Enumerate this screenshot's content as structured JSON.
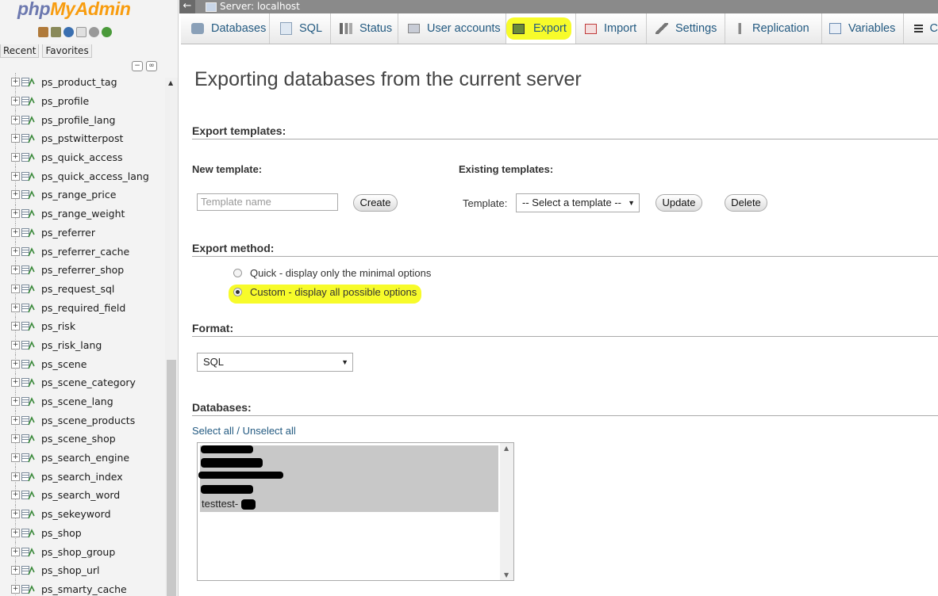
{
  "sidebar": {
    "logo": {
      "php": "php",
      "my": "My",
      "admin": "Admin"
    },
    "nav_icons": [
      "home-icon",
      "logout-icon",
      "help-icon",
      "docs-icon",
      "settings-icon",
      "reload-icon"
    ],
    "tabs": {
      "recent": "Recent",
      "favorites": "Favorites"
    },
    "collapse_all": "−",
    "link_with_main": "∞",
    "expand_glyph": "+",
    "scroll_up": "▲",
    "tables": [
      "ps_product_tag",
      "ps_profile",
      "ps_profile_lang",
      "ps_pstwitterpost",
      "ps_quick_access",
      "ps_quick_access_lang",
      "ps_range_price",
      "ps_range_weight",
      "ps_referrer",
      "ps_referrer_cache",
      "ps_referrer_shop",
      "ps_request_sql",
      "ps_required_field",
      "ps_risk",
      "ps_risk_lang",
      "ps_scene",
      "ps_scene_category",
      "ps_scene_lang",
      "ps_scene_products",
      "ps_scene_shop",
      "ps_search_engine",
      "ps_search_index",
      "ps_search_word",
      "ps_sekeyword",
      "ps_shop",
      "ps_shop_group",
      "ps_shop_url",
      "ps_smarty_cache"
    ]
  },
  "topbar": {
    "back": "←",
    "server": "Server: localhost"
  },
  "tabs": [
    {
      "label": "Databases",
      "icon": "database-icon"
    },
    {
      "label": "SQL",
      "icon": "sql-icon"
    },
    {
      "label": "Status",
      "icon": "status-icon"
    },
    {
      "label": "User accounts",
      "icon": "users-icon"
    },
    {
      "label": "Export",
      "icon": "export-icon",
      "active": true
    },
    {
      "label": "Import",
      "icon": "import-icon"
    },
    {
      "label": "Settings",
      "icon": "wrench-icon"
    },
    {
      "label": "Replication",
      "icon": "replication-icon"
    },
    {
      "label": "Variables",
      "icon": "variables-icon"
    },
    {
      "label": "C",
      "icon": "charset-icon"
    }
  ],
  "main": {
    "title": "Exporting databases from the current server",
    "export_templates": {
      "heading": "Export templates:",
      "new_template_label": "New template:",
      "template_name_placeholder": "Template name",
      "create_button": "Create",
      "existing_templates_label": "Existing templates:",
      "template_label": "Template:",
      "template_select": "-- Select a template --",
      "update_button": "Update",
      "delete_button": "Delete"
    },
    "export_method": {
      "heading": "Export method:",
      "quick": "Quick - display only the minimal options",
      "custom": "Custom - display all possible options",
      "selected": "custom"
    },
    "format": {
      "heading": "Format:",
      "value": "SQL"
    },
    "databases": {
      "heading": "Databases:",
      "select_all": "Select all",
      "separator": " / ",
      "unselect_all": "Unselect all",
      "items": [
        "testtest-"
      ]
    }
  },
  "colors": {
    "highlight": "#f7fb2a",
    "link": "#235a81",
    "logo_php": "#6c78af",
    "logo_admin": "#f89c0e"
  }
}
